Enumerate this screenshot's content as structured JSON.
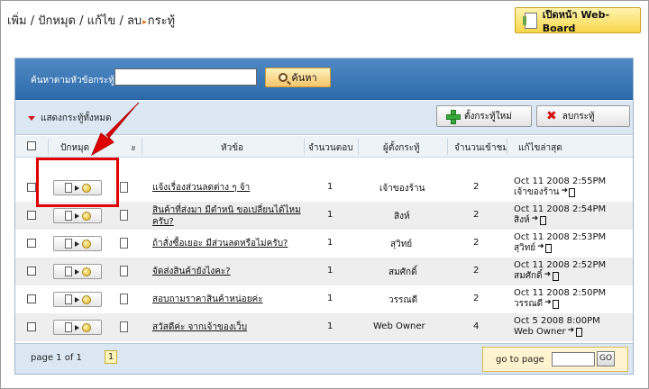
{
  "breadcrumb": {
    "parts": [
      "เพิ่ม",
      "ปักหมุด",
      "แก้ไข",
      "ลบ"
    ],
    "sep": " / ",
    "arrow": "▸",
    "current": "กระทู้"
  },
  "webboard_button": {
    "label": "เปิดหน้า Web-Board",
    "icon": "document-icon"
  },
  "search": {
    "label": "ค้นหาตามหัวข้อกระทู้",
    "value": "",
    "placeholder": "",
    "button_label": "ค้นหา",
    "button_icon": "magnifier-icon"
  },
  "toolbar": {
    "show_all_label": "แสดงกระทู้ทั้งหมด",
    "new_topic_label": "ตั้งกระทู้ใหม่",
    "delete_label": "ลบกระทู้"
  },
  "columns": {
    "pin": "ปักหมุด",
    "status": "สถานะ",
    "topic": "หัวข้อ",
    "replies": "จำนวนตอบ",
    "author": "ผู้ตั้งกระทู้",
    "views": "จำนวนเข้าชม",
    "last_edit": "แก้ไขล่าสุด"
  },
  "rows": [
    {
      "topic": "แจ้งเรื่องส่วนลดต่าง ๆ จ้า",
      "replies": "1",
      "author": "เจ้าของร้าน",
      "views": "2",
      "date": "Oct 11 2008 2:55PM",
      "by": "เจ้าของร้าน"
    },
    {
      "topic": "สินค้าที่ส่งมา มีตำหนิ ขอเปลี่ยนได้ไหมครับ?",
      "replies": "1",
      "author": "สิงห์",
      "views": "2",
      "date": "Oct 11 2008 2:54PM",
      "by": "สิงห์"
    },
    {
      "topic": "ถ้าสั่งซื้อเยอะ มีส่วนลดหรือไม่ครับ?",
      "replies": "1",
      "author": "สุวิทย์",
      "views": "2",
      "date": "Oct 11 2008 2:53PM",
      "by": "สุวิทย์"
    },
    {
      "topic": "จัดส่งสินค้ายังไงคะ?",
      "replies": "1",
      "author": "สมศักดิ์",
      "views": "2",
      "date": "Oct 11 2008 2:52PM",
      "by": "สมศักดิ์"
    },
    {
      "topic": "สอบถามราคาสินค้าหน่อยค่ะ",
      "replies": "1",
      "author": "วรรณดี",
      "views": "2",
      "date": "Oct 11 2008 2:50PM",
      "by": "วรรณดี"
    },
    {
      "topic": "สวัสดีค่ะ จากเจ้าของเว็บ",
      "replies": "1",
      "author": "Web Owner",
      "views": "4",
      "date": "Oct 5 2008 8:00PM",
      "by": "Web Owner"
    }
  ],
  "pagination": {
    "info": "page 1 of 1",
    "current_page": "1",
    "goto_label": "go to page",
    "goto_value": "",
    "go_button": "GO"
  },
  "colors": {
    "searchbar": "#2e6aaa",
    "toolbar": "#dbe7f3",
    "accent_yellow": "#f7d64a",
    "annotation_red": "#e00000"
  }
}
